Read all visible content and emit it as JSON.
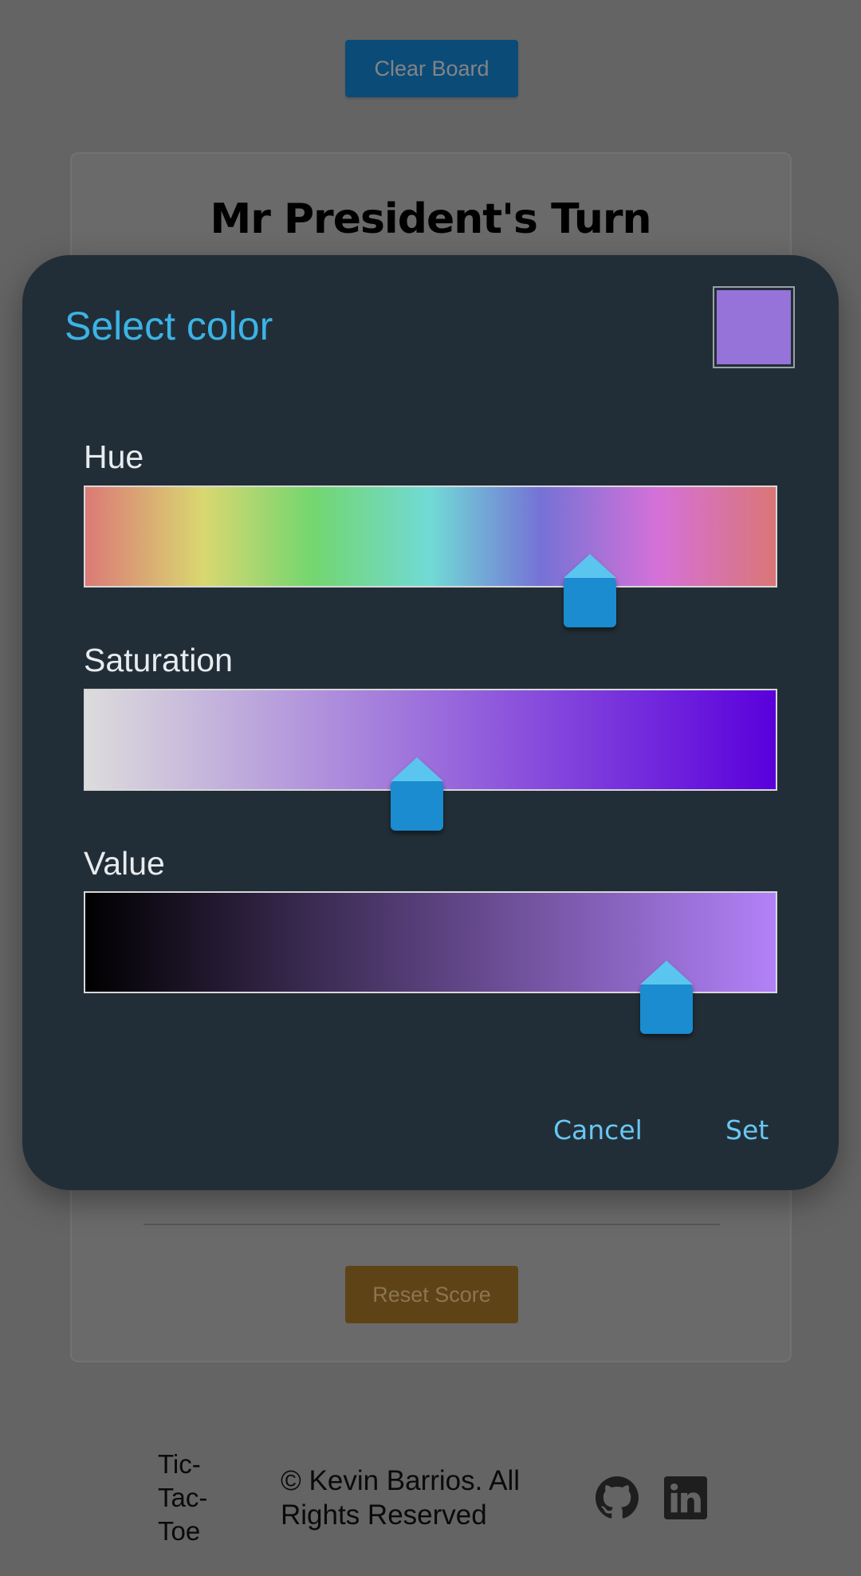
{
  "page": {
    "clear_board_label": "Clear Board",
    "turn_title": "Mr President's Turn",
    "reset_score_label": "Reset Score"
  },
  "footer": {
    "brand_lines": [
      "Tic-",
      "Tac-",
      "Toe"
    ],
    "copyright": "© Kevin Barrios. All Rights Reserved",
    "icons": [
      "github-icon",
      "linkedin-icon"
    ]
  },
  "dialog": {
    "title": "Select color",
    "preview_color": "#9573d8",
    "sliders": [
      {
        "label": "Hue",
        "value_fraction": 0.73
      },
      {
        "label": "Saturation",
        "value_fraction": 0.48
      },
      {
        "label": "Value",
        "value_fraction": 0.84
      }
    ],
    "cancel_label": "Cancel",
    "set_label": "Set",
    "accent_color": "#3cb3e6",
    "thumb_color": "#1a8ccf"
  }
}
